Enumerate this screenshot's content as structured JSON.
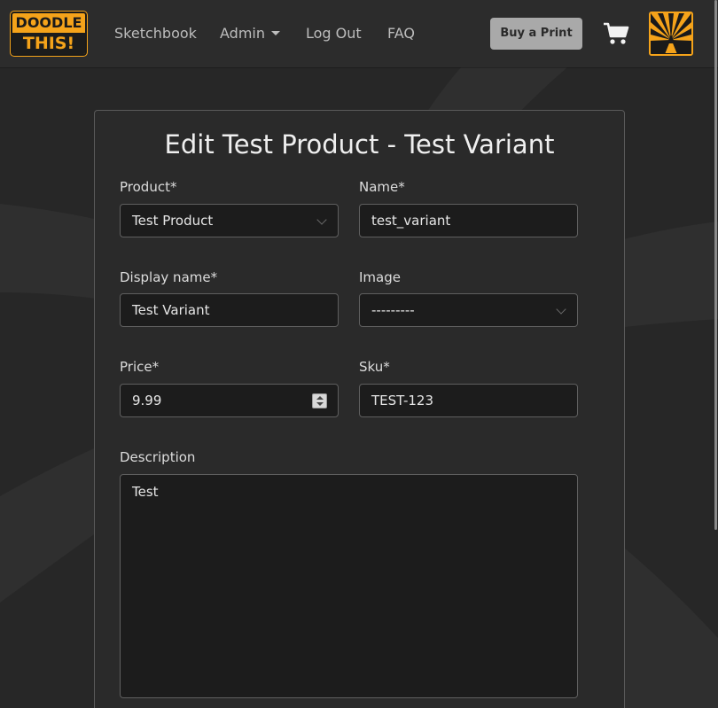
{
  "navbar": {
    "logo": {
      "line1": "DOODLE",
      "line2": "THIS!"
    },
    "links": {
      "sketchbook": "Sketchbook",
      "admin": "Admin",
      "logout": "Log Out",
      "faq": "FAQ"
    },
    "buy_label": "Buy a Print",
    "cart_icon": "cart-icon",
    "avatar_icon": "pencil-sunburst-icon"
  },
  "form": {
    "title": "Edit Test Product - Test Variant",
    "product": {
      "label": "Product*",
      "value": "Test Product"
    },
    "name": {
      "label": "Name*",
      "value": "test_variant"
    },
    "display_name": {
      "label": "Display name*",
      "value": "Test Variant"
    },
    "image": {
      "label": "Image",
      "value": "---------"
    },
    "price": {
      "label": "Price*",
      "value": "9.99"
    },
    "sku": {
      "label": "Sku*",
      "value": "TEST-123"
    },
    "description": {
      "label": "Description",
      "value": "Test"
    }
  },
  "colors": {
    "accent": "#f5a31a",
    "background": "#272727",
    "card": "#2a2a2a",
    "field": "#1c1c1c"
  }
}
